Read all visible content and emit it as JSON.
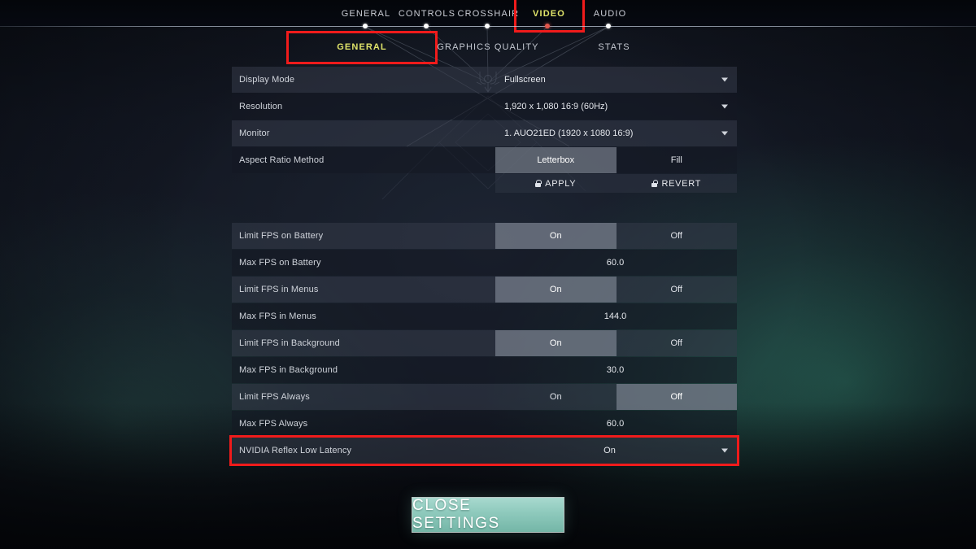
{
  "top_nav": {
    "items": [
      {
        "label": "GENERAL",
        "active": false,
        "highlighted": false
      },
      {
        "label": "CONTROLS",
        "active": false,
        "highlighted": false
      },
      {
        "label": "CROSSHAIR",
        "active": false,
        "highlighted": false
      },
      {
        "label": "VIDEO",
        "active": true,
        "highlighted": true
      },
      {
        "label": "AUDIO",
        "active": false,
        "highlighted": false
      }
    ]
  },
  "sub_nav": {
    "items": [
      {
        "label": "GENERAL",
        "active": true,
        "highlighted": true
      },
      {
        "label": "GRAPHICS QUALITY",
        "active": false,
        "highlighted": false
      },
      {
        "label": "STATS",
        "active": false,
        "highlighted": false
      }
    ]
  },
  "settings": {
    "rows": [
      {
        "label": "Display Mode",
        "type": "dropdown",
        "value": "Fullscreen",
        "align": "left",
        "shade": "a",
        "highlighted": false
      },
      {
        "label": "Resolution",
        "type": "dropdown",
        "value": "1,920 x 1,080 16:9 (60Hz)",
        "align": "left",
        "shade": "b",
        "highlighted": false
      },
      {
        "label": "Monitor",
        "type": "dropdown",
        "value": "1. AUO21ED (1920 x  1080 16:9)",
        "align": "left",
        "shade": "a",
        "highlighted": false
      },
      {
        "label": "Aspect Ratio Method",
        "type": "segmented",
        "options": [
          "Letterbox",
          "Fill"
        ],
        "selected": 0,
        "shade": "b",
        "highlighted": false
      },
      {
        "label": "Limit FPS on Battery",
        "type": "segmented",
        "options": [
          "On",
          "Off"
        ],
        "selected": 0,
        "shade": "a",
        "highlighted": false
      },
      {
        "label": "Max FPS on Battery",
        "type": "value",
        "value": "60.0",
        "shade": "b",
        "highlighted": false
      },
      {
        "label": "Limit FPS in Menus",
        "type": "segmented",
        "options": [
          "On",
          "Off"
        ],
        "selected": 0,
        "shade": "a",
        "highlighted": false
      },
      {
        "label": "Max FPS in Menus",
        "type": "value",
        "value": "144.0",
        "shade": "b",
        "highlighted": false
      },
      {
        "label": "Limit FPS in Background",
        "type": "segmented",
        "options": [
          "On",
          "Off"
        ],
        "selected": 0,
        "shade": "a",
        "highlighted": false
      },
      {
        "label": "Max FPS in Background",
        "type": "value",
        "value": "30.0",
        "shade": "b",
        "highlighted": false
      },
      {
        "label": "Limit FPS Always",
        "type": "segmented",
        "options": [
          "On",
          "Off"
        ],
        "selected": 1,
        "shade": "a",
        "highlighted": false
      },
      {
        "label": "Max FPS Always",
        "type": "value",
        "value": "60.0",
        "shade": "b",
        "highlighted": false
      },
      {
        "label": "NVIDIA Reflex Low Latency",
        "type": "dropdown",
        "value": "On",
        "align": "center",
        "shade": "a",
        "highlighted": true
      }
    ],
    "action_bar": {
      "apply_label": "APPLY",
      "revert_label": "REVERT",
      "apply_icon": "lock-icon",
      "revert_icon": "lock-icon"
    },
    "gap_after_row_index": 3
  },
  "footer": {
    "close_label": "CLOSE SETTINGS"
  },
  "colors": {
    "accent_active": "#e0e46a",
    "highlight_box": "#f01b1b",
    "close_button": "#8fcabd",
    "selected_segment": "#848c9a"
  }
}
